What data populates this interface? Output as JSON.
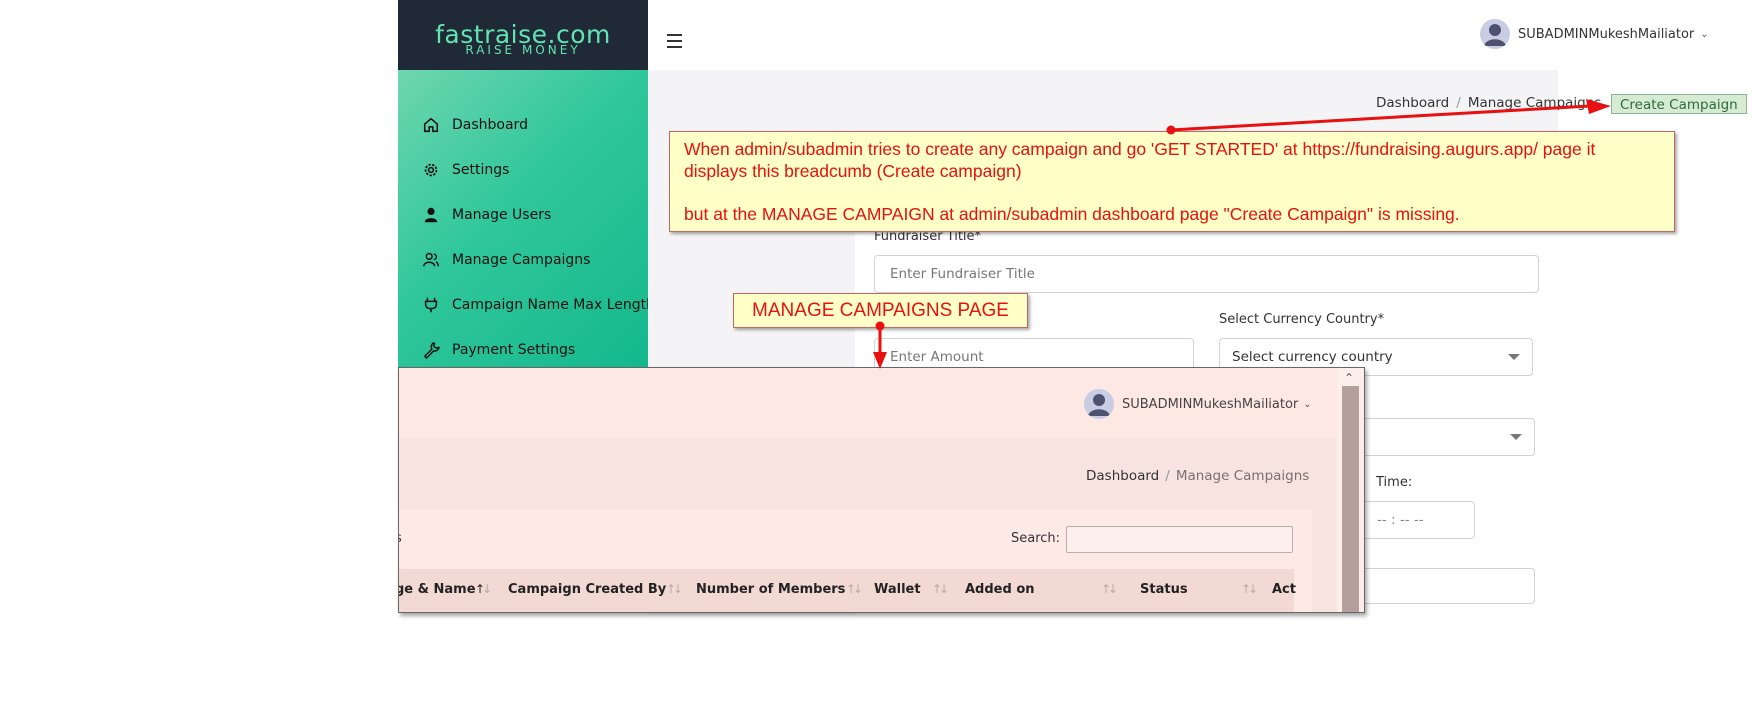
{
  "brand": {
    "name": "fastraise.com",
    "tagline": "RAISE MONEY"
  },
  "sidebar": {
    "items": [
      {
        "label": "Dashboard",
        "icon": "home-icon"
      },
      {
        "label": "Settings",
        "icon": "gear-icon"
      },
      {
        "label": "Manage Users",
        "icon": "user-icon"
      },
      {
        "label": "Manage Campaigns",
        "icon": "users-icon"
      },
      {
        "label": "Campaign Name Max Length",
        "icon": "plug-icon"
      },
      {
        "label": "Payment Settings",
        "icon": "wrench-icon"
      }
    ]
  },
  "header": {
    "menu_icon": "hamburger-icon",
    "username": "SUBADMINMukeshMailiator"
  },
  "breadcrumb": {
    "items": [
      "Dashboard",
      "Manage Campaigns"
    ],
    "active": "Create Campaign"
  },
  "form": {
    "title_label": "Fundraiser Title*",
    "title_placeholder": "Enter Fundraiser Title",
    "amount_placeholder": "Enter Amount",
    "currency_label": "Select Currency Country*",
    "currency_value": "Select currency country",
    "time_label": "Time:",
    "time_value": "-- : --  --"
  },
  "annotations": {
    "note_line1": "When admin/subadmin tries to create any campaign and go 'GET STARTED' at https://fundraising.augurs.app/ page it displays this breadcumb (Create campaign)",
    "note_line2": "but at the MANAGE CAMPAIGN at admin/subadmin dashboard page \"Create Campaign\" is missing.",
    "manage_label": "MANAGE CAMPAIGNS PAGE",
    "accent": "#e81010"
  },
  "inset": {
    "username": "SUBADMINMukeshMailiator",
    "breadcrumb": [
      "Dashboard",
      "Manage Campaigns"
    ],
    "partial_text": "s",
    "search_label": "Search:",
    "columns": [
      "ge & Name",
      "Campaign Created By",
      "Number of Members",
      "Wallet",
      "Added on",
      "Status",
      "Act"
    ]
  }
}
